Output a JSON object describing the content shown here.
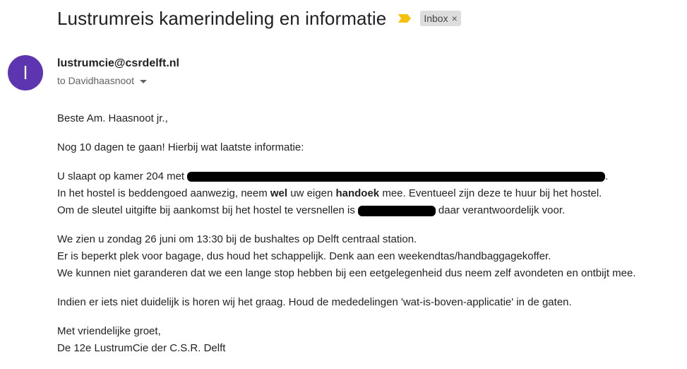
{
  "subject": "Lustrumreis kamerindeling en informatie",
  "label": {
    "name": "Inbox",
    "close": "×"
  },
  "sender": {
    "avatar_letter": "l",
    "email": "lustrumcie@csrdelft.nl",
    "to_line": "to Davidhaasnoot"
  },
  "body": {
    "greeting": "Beste Am. Haasnoot jr.,",
    "intro": "Nog 10 dagen te gaan! Hierbij wat laatste informatie:",
    "room": {
      "line1_prefix": "U slaapt op kamer 204 met",
      "line1_suffix": ".",
      "line2_a": "In het hostel is beddengoed aanwezig, neem ",
      "line2_b": "wel",
      "line2_c": " uw eigen ",
      "line2_d": "handoek",
      "line2_e": " mee. Eventueel zijn deze te huur bij het hostel.",
      "line3_prefix": "Om de sleutel uitgifte bij aankomst bij het hostel te versnellen is",
      "line3_suffix": "daar verantwoordelijk voor."
    },
    "travel": {
      "line1": "We zien u zondag 26 juni om 13:30 bij de bushaltes op Delft centraal station.",
      "line2": "Er is beperkt plek voor bagage, dus houd het schappelijk. Denk aan een weekendtas/handbaggagekoffer.",
      "line3": "We kunnen niet garanderen dat we een lange stop hebben bij een eetgelegenheid dus neem zelf avondeten en ontbijt mee."
    },
    "questions": "Indien er iets niet duidelijk is horen wij het graag. Houd de mededelingen 'wat-is-boven-applicatie' in de gaten.",
    "closing": "Met vriendelijke groet,",
    "signature": "De 12e LustrumCie der C.S.R. Delft"
  },
  "colors": {
    "avatar": "#5e35b1",
    "important_marker": "#f4c20d",
    "chip_bg": "#dddddd"
  }
}
